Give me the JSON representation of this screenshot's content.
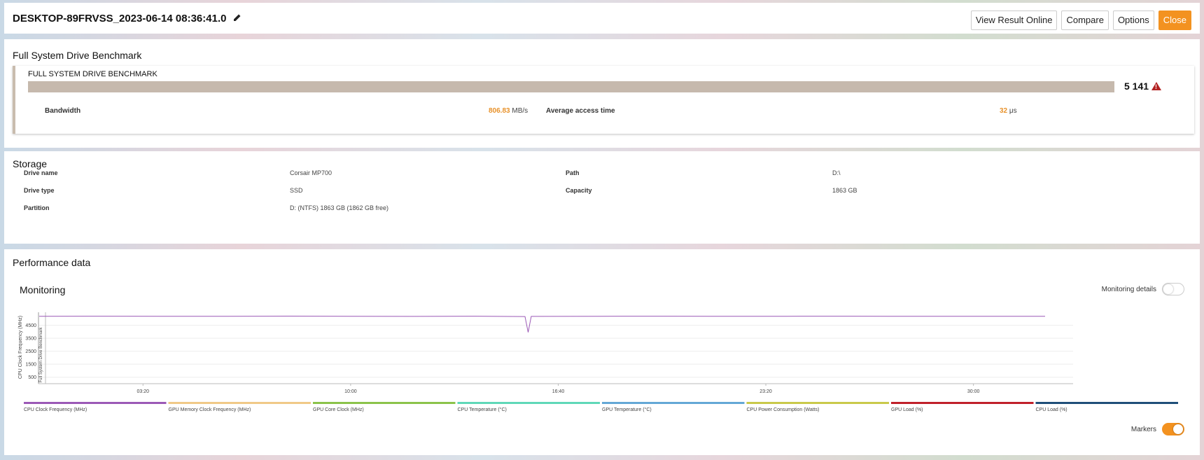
{
  "header": {
    "title": "DESKTOP-89FRVSS_2023-06-14 08:36:41.0",
    "buttons": {
      "view_online": "View Result Online",
      "compare": "Compare",
      "options": "Options",
      "close": "Close"
    }
  },
  "benchmark": {
    "section_title": "Full System Drive Benchmark",
    "name": "FULL SYSTEM DRIVE BENCHMARK",
    "score": "5 141",
    "bandwidth_label": "Bandwidth",
    "bandwidth_value": "806.83",
    "bandwidth_unit": "MB/s",
    "access_label": "Average access time",
    "access_value": "32",
    "access_unit": "μs"
  },
  "storage": {
    "section_title": "Storage",
    "drive_name_label": "Drive name",
    "drive_name": "Corsair MP700",
    "path_label": "Path",
    "path": "D:\\",
    "drive_type_label": "Drive type",
    "drive_type": "SSD",
    "capacity_label": "Capacity",
    "capacity": "1863 GB",
    "partition_label": "Partition",
    "partition": "D: (NTFS) 1863 GB (1862 GB free)"
  },
  "performance": {
    "section_title": "Performance data",
    "monitoring_title": "Monitoring",
    "monitoring_details_label": "Monitoring details",
    "monitoring_details_on": false,
    "markers_label": "Markers",
    "markers_on": true
  },
  "colors": {
    "accent": "#f39220",
    "bench_bar": "#c6b9ad",
    "cpu_line": "#9b59b6"
  },
  "chart_data": {
    "type": "line",
    "ylabel": "CPU Clock Frequency (MHz)",
    "marker_label": "Full System Drive Benchmark",
    "yticks": [
      500,
      1500,
      2500,
      3500,
      4500
    ],
    "xticks": [
      "03:20",
      "10:00",
      "16:40",
      "23:20",
      "30:00"
    ],
    "ylim": [
      0,
      5500
    ],
    "series": [
      {
        "name": "CPU Clock Frequency (MHz)",
        "color": "#9b59b6",
        "x_minutes": [
          0,
          2,
          4,
          6,
          8,
          10,
          12,
          14,
          15.6,
          15.7,
          15.8,
          18,
          20,
          22,
          24,
          26,
          28,
          30,
          32,
          32.3
        ],
        "values": [
          5190,
          5200,
          5185,
          5195,
          5205,
          5190,
          5180,
          5200,
          5170,
          3950,
          5180,
          5195,
          5200,
          5185,
          5190,
          5200,
          5185,
          5195,
          5190,
          5185
        ]
      }
    ],
    "legend": [
      {
        "name": "CPU Clock Frequency (MHz)",
        "color": "#9b59b6"
      },
      {
        "name": "GPU Memory Clock Frequency (MHz)",
        "color": "#f0c987"
      },
      {
        "name": "GPU Core Clock (MHz)",
        "color": "#8bc34a"
      },
      {
        "name": "CPU Temperature (°C)",
        "color": "#5fd8b8"
      },
      {
        "name": "GPU Temperature (°C)",
        "color": "#64a8d6"
      },
      {
        "name": "CPU Power Consumption (Watts)",
        "color": "#c9c94a"
      },
      {
        "name": "GPU Load (%)",
        "color": "#c0202a"
      },
      {
        "name": "CPU Load (%)",
        "color": "#1f4e79"
      }
    ]
  }
}
